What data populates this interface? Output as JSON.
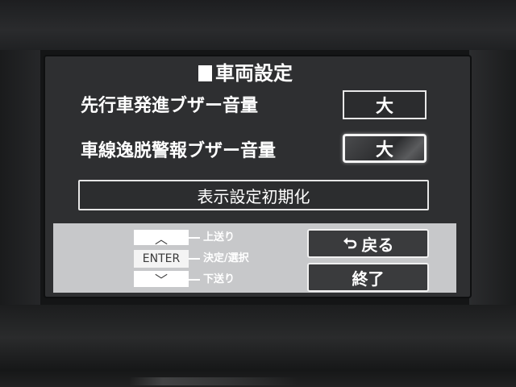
{
  "screen": {
    "title": "車両設定",
    "settings": [
      {
        "label": "先行車発進ブザー音量",
        "value": "大",
        "selected": false
      },
      {
        "label": "車線逸脱警報ブザー音量",
        "value": "大",
        "selected": true
      }
    ],
    "reset_button": "表示設定初期化"
  },
  "help": {
    "up_key": "︿",
    "up_desc": "上送り",
    "enter_key": "ENTER",
    "enter_desc": "決定/選択",
    "down_key": "﹀",
    "down_desc": "下送り",
    "back_icon": "return-arrow-icon",
    "back_label": "戻る",
    "end_label": "終了"
  }
}
